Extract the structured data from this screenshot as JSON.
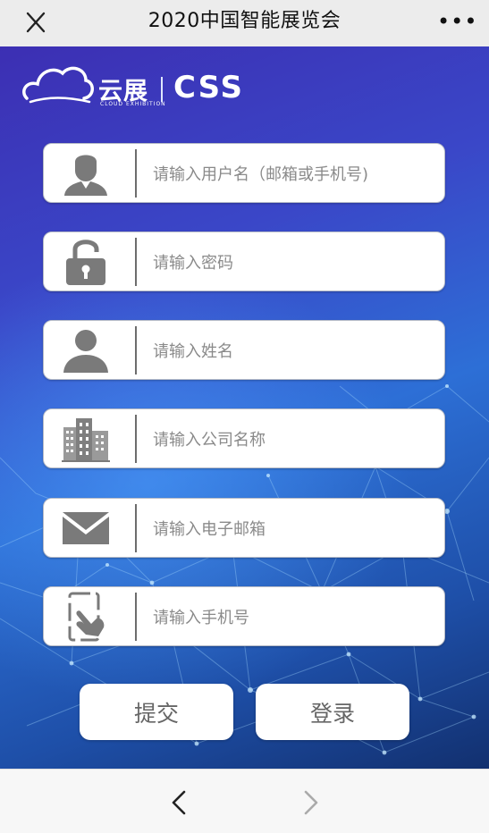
{
  "topbar": {
    "title": "2020中国智能展览会",
    "close_icon": "close-icon",
    "more_label": "•••"
  },
  "brand": {
    "name_zh": "云展",
    "sub_en": "CLOUD EXHIBITION",
    "name_en": "CSS",
    "logo_icon": "cloud-logo-icon"
  },
  "form": {
    "username": {
      "placeholder": "请输入用户名（邮箱或手机号)",
      "value": "",
      "icon": "user-icon"
    },
    "password": {
      "placeholder": "请输入密码",
      "value": "",
      "icon": "lock-icon"
    },
    "name": {
      "placeholder": "请输入姓名",
      "value": "",
      "icon": "person-icon"
    },
    "company": {
      "placeholder": "请输入公司名称",
      "value": "",
      "icon": "building-icon"
    },
    "email": {
      "placeholder": "请输入电子邮箱",
      "value": "",
      "icon": "envelope-icon"
    },
    "phone": {
      "placeholder": "请输入手机号",
      "value": "",
      "icon": "phone-touch-icon"
    }
  },
  "buttons": {
    "submit_label": "提交",
    "login_label": "登录"
  },
  "bottombar": {
    "back_icon": "chevron-left-icon",
    "forward_icon": "chevron-right-icon",
    "forward_enabled": false
  },
  "colors": {
    "background_top": "#3c2fb3",
    "background_bottom": "#12306f",
    "icon_gray": "#7a7a7a",
    "button_text": "#666666"
  }
}
